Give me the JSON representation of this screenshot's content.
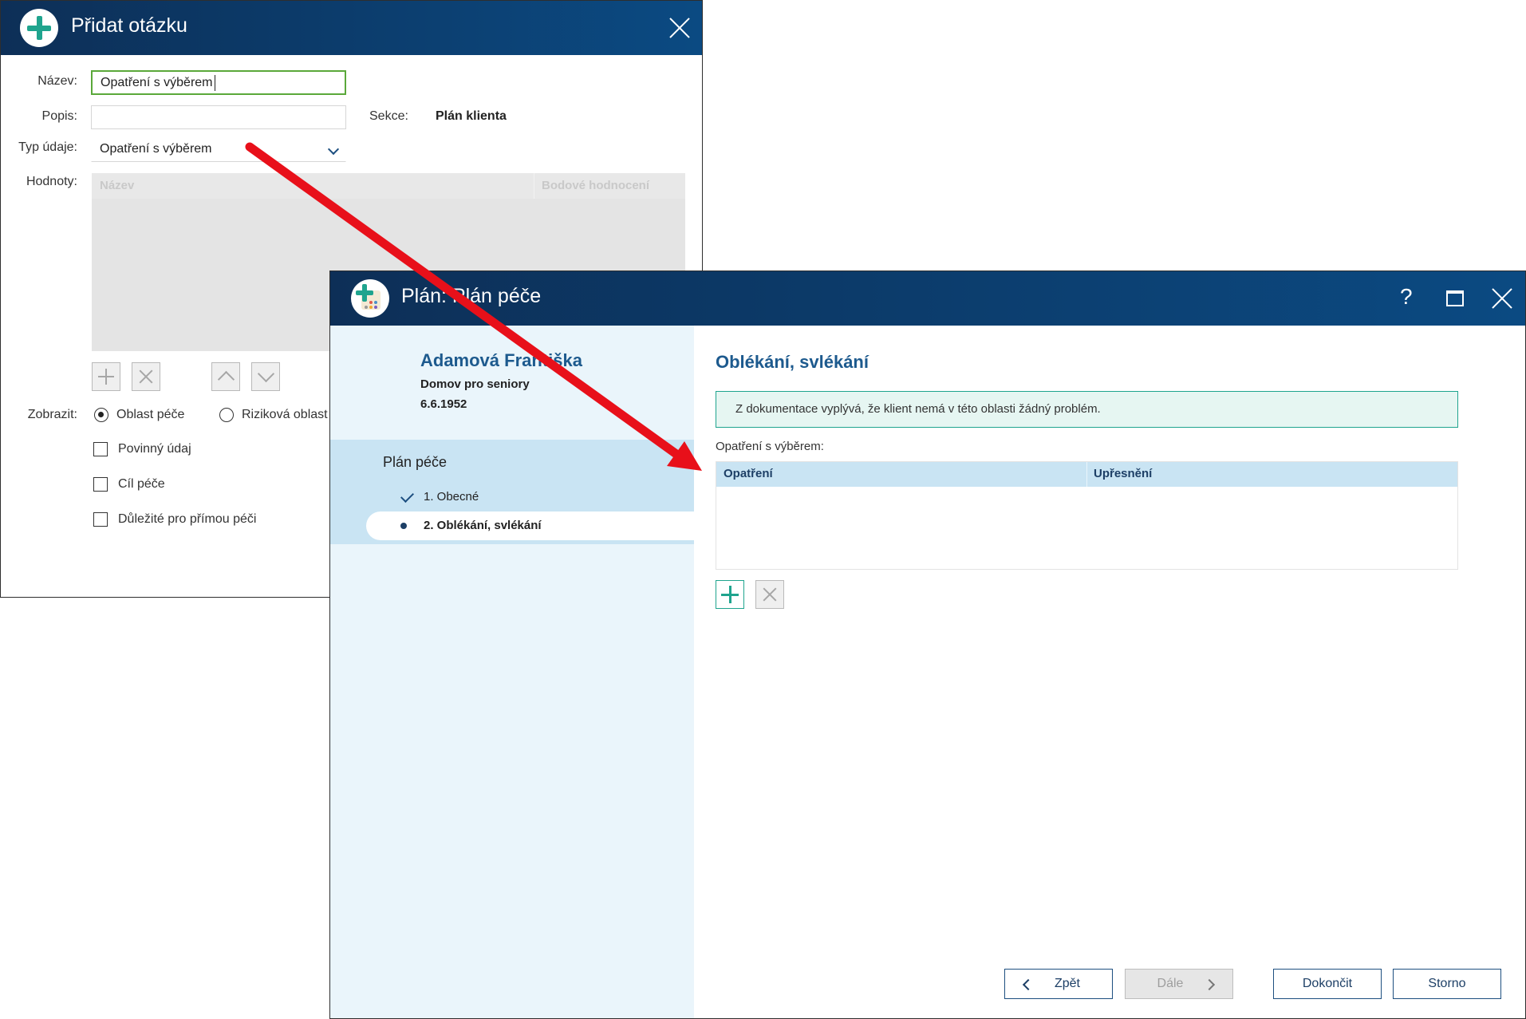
{
  "dialog_add_question": {
    "title": "Přidat otázku",
    "fields": {
      "name_label": "Název:",
      "name_value": "Opatření s výběrem",
      "description_label": "Popis:",
      "description_value": "",
      "section_label": "Sekce:",
      "section_value": "Plán klienta",
      "type_label": "Typ údaje:",
      "type_value": "Opatření s výběrem",
      "values_label": "Hodnoty:",
      "values_columns": [
        "Název",
        "Bodové hodnocení"
      ]
    },
    "display_label": "Zobrazit:",
    "display_options": {
      "care_area": "Oblast péče",
      "risk_area": "Riziková oblast",
      "selected": "Oblast péče"
    },
    "checkboxes": {
      "required": "Povinný údaj",
      "care_goal": "Cíl péče",
      "important_direct_care": "Důležité pro přímou péči"
    }
  },
  "dialog_plan": {
    "title": "Plán: Plán péče",
    "window_controls": {
      "help": "?"
    },
    "patient": {
      "name": "Adamová Františka",
      "facility": "Domov pro seniory",
      "birth_date": "6.6.1952"
    },
    "nav": {
      "title": "Plán péče",
      "items": [
        {
          "label": "1. Obecné",
          "state": "done"
        },
        {
          "label": "2. Oblékání, svlékání",
          "state": "active"
        }
      ]
    },
    "content": {
      "title": "Oblékání, svlékání",
      "info": "Z dokumentace vyplývá, že klient nemá v této oblasti žádný problém.",
      "section_label": "Opatření s výběrem:",
      "table_columns": [
        "Opatření",
        "Upřesnění"
      ]
    },
    "footer": {
      "back": "Zpět",
      "next": "Dále",
      "finish": "Dokončit",
      "cancel": "Storno"
    }
  },
  "colors": {
    "titlebar": "#0d2f57",
    "accent_green": "#1fa48e",
    "heading_blue": "#1d5a8e",
    "arrow_red": "#e8101a"
  }
}
